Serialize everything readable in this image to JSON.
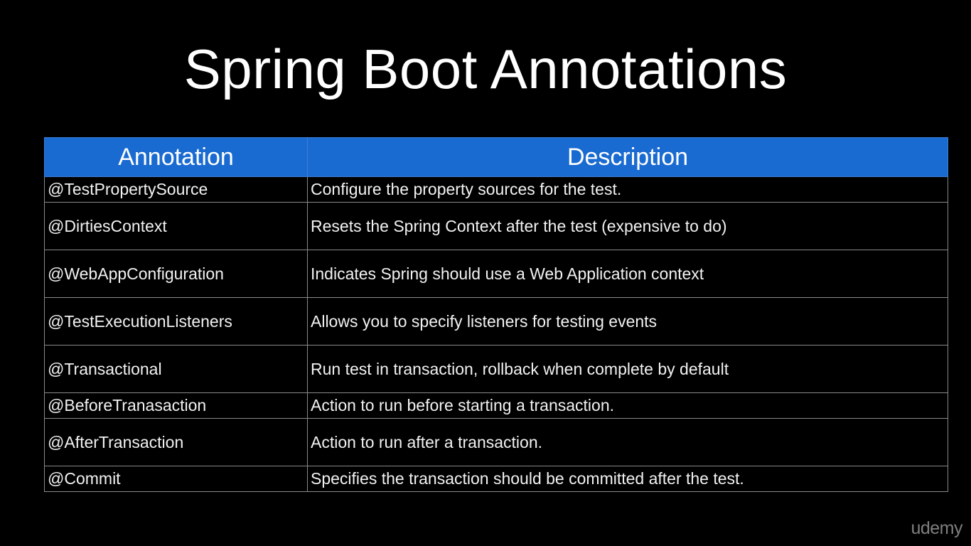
{
  "title": "Spring Boot Annotations",
  "table": {
    "headers": [
      "Annotation",
      "Description"
    ],
    "rows": [
      {
        "annotation": "@TestPropertySource",
        "description": "Configure the property sources for the test."
      },
      {
        "annotation": "@DirtiesContext",
        "description": "Resets the Spring Context after the test (expensive to do)"
      },
      {
        "annotation": "@WebAppConfiguration",
        "description": "Indicates Spring should use a Web Application context"
      },
      {
        "annotation": "@TestExecutionListeners",
        "description": "Allows you to specify listeners for testing events"
      },
      {
        "annotation": "@Transactional",
        "description": "Run test in transaction, rollback when complete by default"
      },
      {
        "annotation": "@BeforeTranasaction",
        "description": "Action to run before starting a transaction."
      },
      {
        "annotation": "@AfterTransaction",
        "description": "Action to run after a transaction."
      },
      {
        "annotation": "@Commit",
        "description": "Specifies the transaction should be committed after the test."
      }
    ]
  },
  "watermark": "udemy",
  "colors": {
    "background": "#000000",
    "header_bg": "#1a6bd1",
    "text": "#ffffff"
  }
}
